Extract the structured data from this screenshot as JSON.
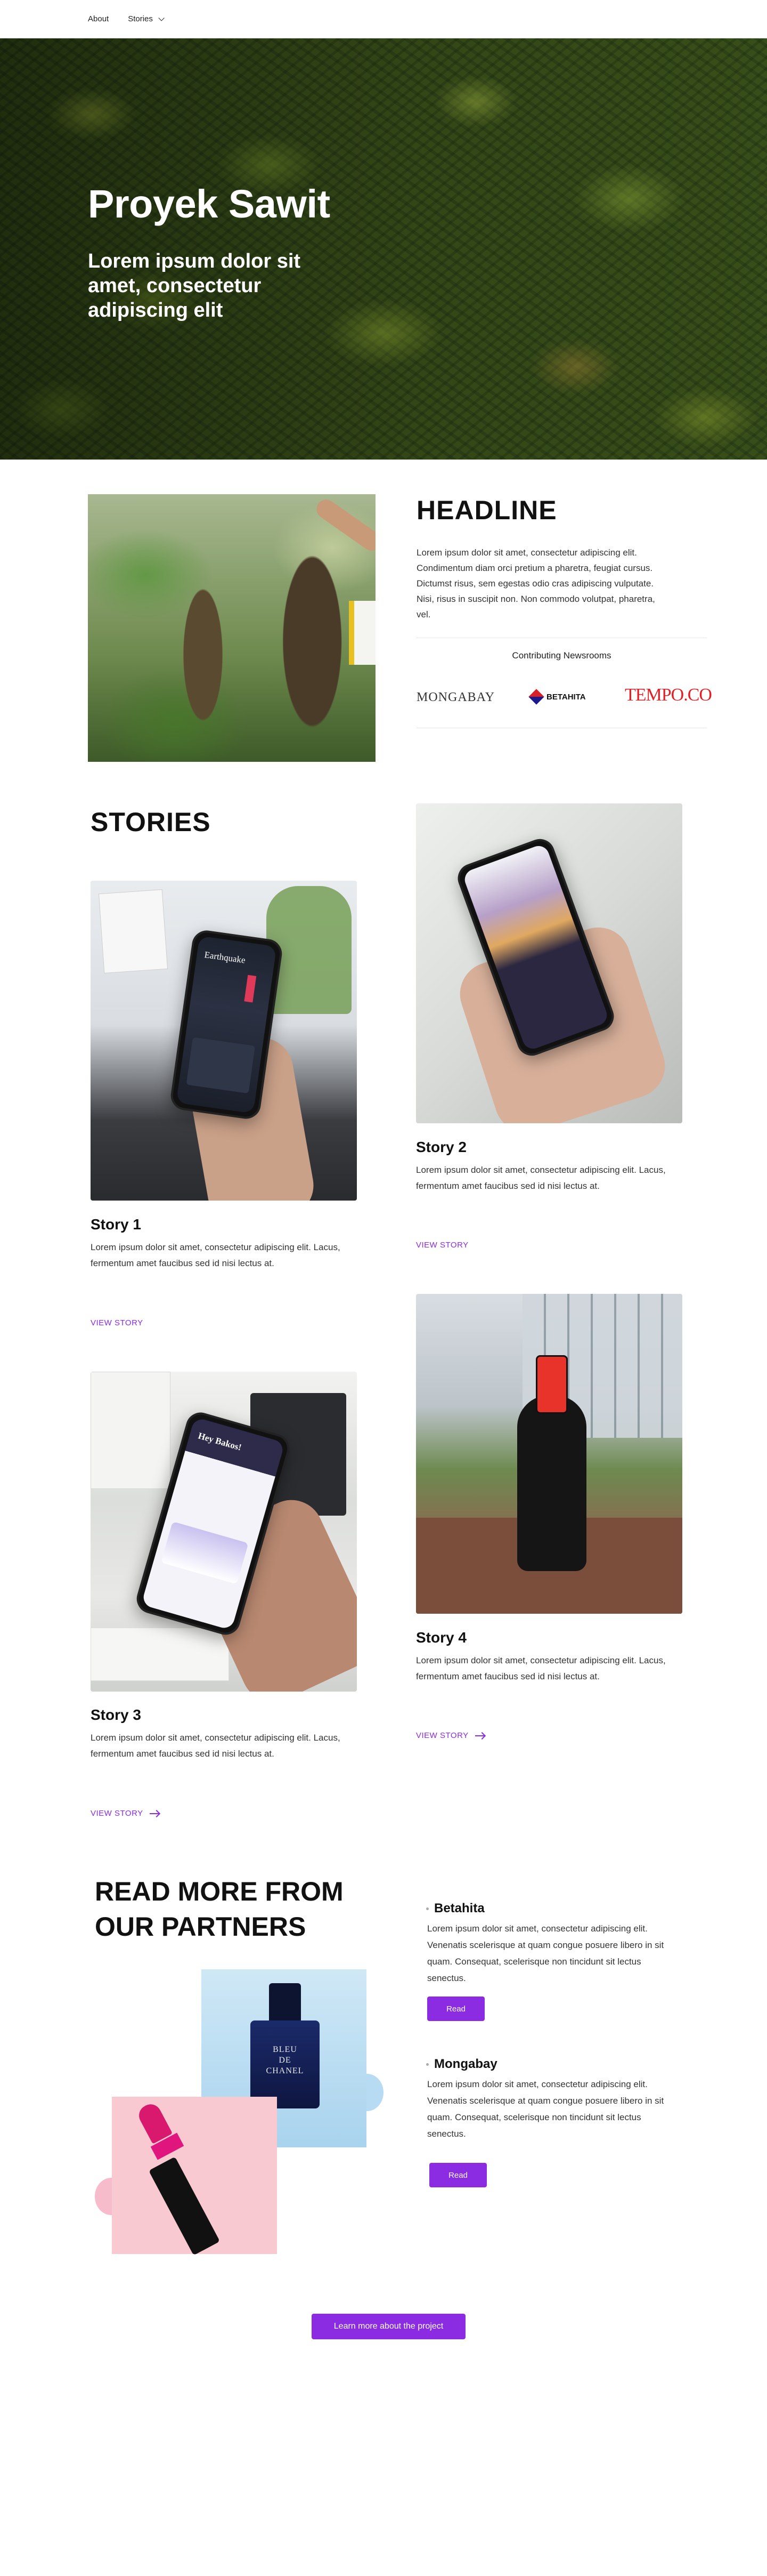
{
  "nav": {
    "about": "About",
    "stories": "Stories"
  },
  "hero": {
    "title": "Proyek Sawit",
    "subtitle": "Lorem ipsum dolor sit amet, consectetur adipiscing elit"
  },
  "intro": {
    "headline": "HEADLINE",
    "body": "Lorem ipsum dolor sit amet, consectetur adipiscing elit. Condimentum diam orci pretium a pharetra, feugiat cursus. Dictumst risus, sem egestas odio cras adipiscing vulputate. Nisi, risus in suscipit non. Non commodo volutpat, pharetra, vel.",
    "contributing_label": "Contributing Newsrooms",
    "logos": {
      "mongabay": "MONGABAY",
      "betahita": "BETAHITA",
      "tempo": "TEMPO.CO"
    }
  },
  "stories": {
    "title": "STORIES",
    "items": [
      {
        "title": "Story 1",
        "body": "Lorem ipsum dolor sit amet, consectetur adipiscing elit. Lacus, fermentum amet faucibus sed id nisi lectus at.",
        "link": "VIEW STORY"
      },
      {
        "title": "Story 2",
        "body": "Lorem ipsum dolor sit amet, consectetur adipiscing elit. Lacus, fermentum amet faucibus sed id nisi lectus at.",
        "link": "VIEW STORY"
      },
      {
        "title": "Story 3",
        "body": "Lorem ipsum dolor sit amet, consectetur adipiscing elit. Lacus, fermentum amet faucibus sed id nisi lectus at.",
        "link": "VIEW STORY"
      },
      {
        "title": "Story 4",
        "body": "Lorem ipsum dolor sit amet, consectetur adipiscing elit. Lacus, fermentum amet faucibus sed id nisi lectus at.",
        "link": "VIEW STORY"
      }
    ],
    "phone_texts": {
      "earthquake": "Earthquake",
      "hey_bakos": "Hey Bakos!"
    }
  },
  "partners": {
    "title": "READ MORE FROM OUR PARTNERS",
    "bottle_label": "BLEU\nDE\nCHANEL",
    "items": [
      {
        "name": "Betahita",
        "body": "Lorem ipsum dolor sit amet, consectetur adipiscing elit. Venenatis scelerisque at quam congue posuere libero in sit quam. Consequat, scelerisque non tincidunt sit lectus senectus.",
        "button": "Read"
      },
      {
        "name": "Mongabay",
        "body": "Lorem ipsum dolor sit amet, consectetur adipiscing elit. Venenatis scelerisque at quam congue posuere libero in sit quam. Consequat, scelerisque non tincidunt sit lectus senectus.",
        "button": "Read"
      }
    ]
  },
  "cta": {
    "label": "Learn more about the project"
  },
  "colors": {
    "accent": "#8b2be2",
    "text": "#1a1a1a"
  }
}
